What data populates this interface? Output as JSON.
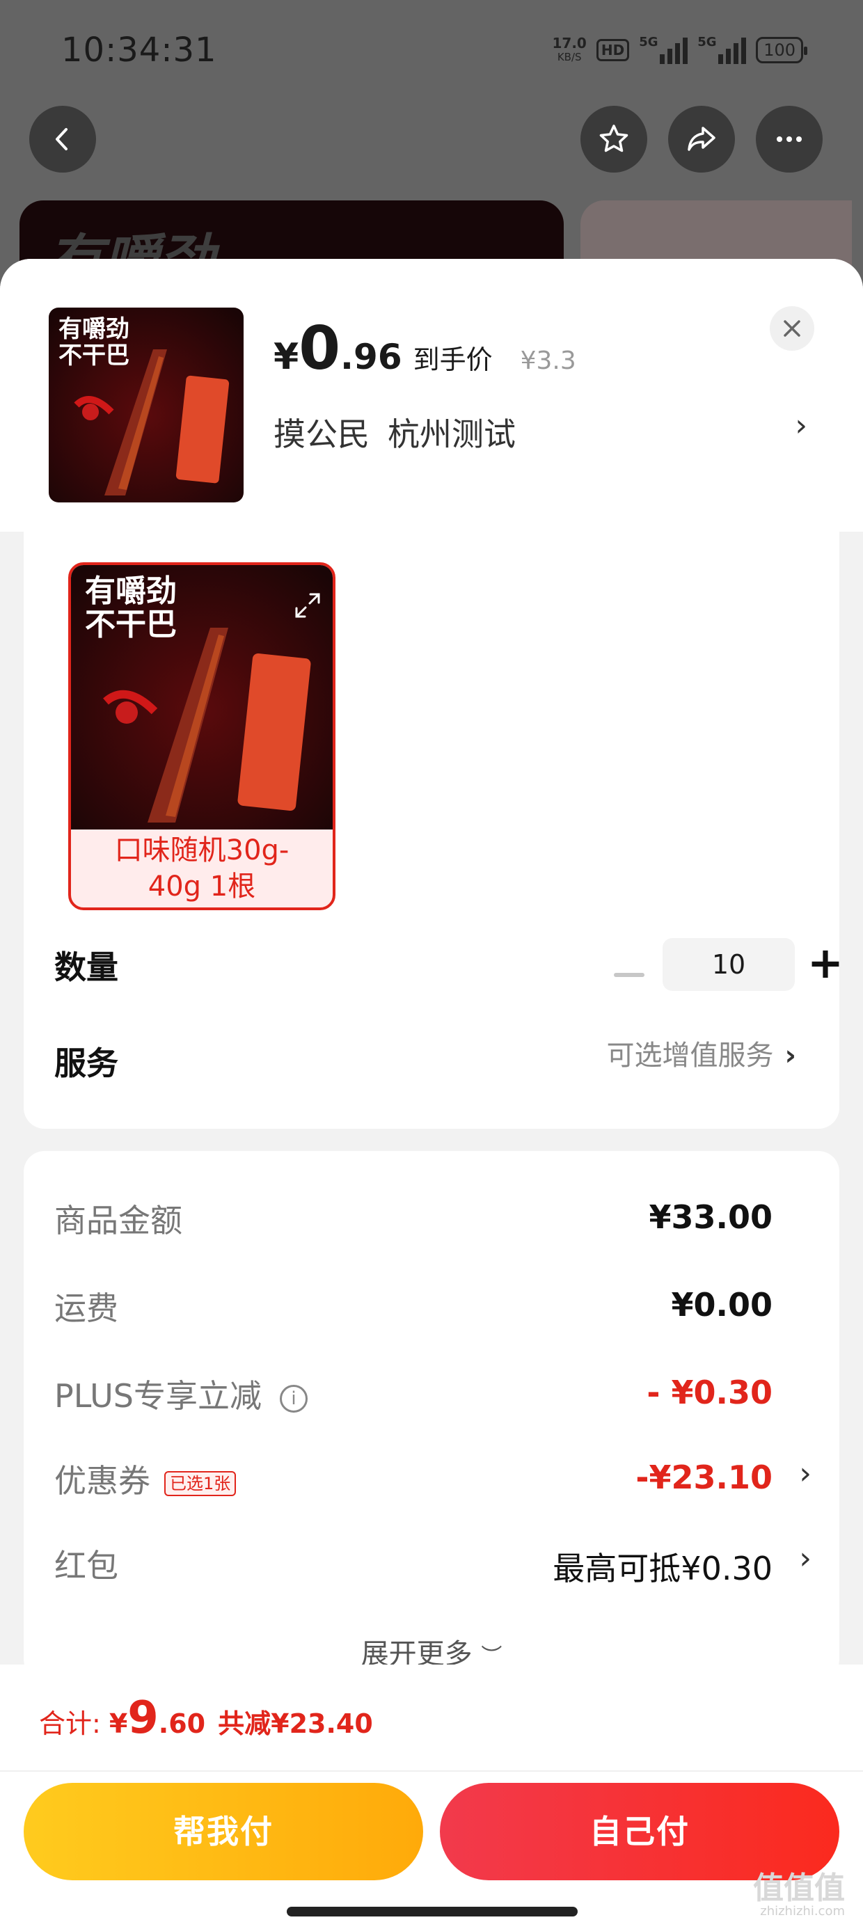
{
  "status_bar": {
    "time": "10:34:31",
    "net_speed": "17.0",
    "net_unit": "KB/S",
    "hd": "HD",
    "sig1": "5G",
    "sig2": "5G",
    "battery": "100"
  },
  "product": {
    "thumb_line1": "有嚼劲",
    "thumb_line2": "不干巴",
    "price_yen": "¥",
    "price_int": "0",
    "price_dec": ".96",
    "price_label": "到手价",
    "original_price": "¥3.3",
    "shop_name": "摸公民",
    "shop_city": "杭州测试"
  },
  "spec": {
    "selected_label_line1": "口味随机30g-",
    "selected_label_line2": "40g 1根",
    "quantity_label": "数量",
    "quantity_value": "10",
    "service_label": "服务",
    "service_hint": "可选增值服务"
  },
  "details": {
    "rows": [
      {
        "label": "商品金额",
        "value": "¥33.00"
      },
      {
        "label": "运费",
        "value": "¥0.00"
      },
      {
        "label": "PLUS专享立减",
        "value": "- ¥0.30"
      },
      {
        "label": "优惠券",
        "badge": "已选1张",
        "value": "-¥23.10"
      },
      {
        "label": "红包",
        "value": "最高可抵¥0.30"
      }
    ],
    "expand_more": "展开更多"
  },
  "footer": {
    "total_label": "合计:",
    "total_yen": "¥",
    "total_int": "9",
    "total_dec": ".60",
    "total_saved": "共减¥23.40",
    "help_pay": "帮我付",
    "self_pay": "自己付"
  },
  "watermark": {
    "text": "值值值",
    "site": "zhizhizhi.com"
  },
  "colors": {
    "accent_red": "#e1251b",
    "help_pay_yellow": "#ffb90f",
    "self_pay_red": "#f5303d"
  },
  "icons": [
    "back-icon",
    "star-icon",
    "share-icon",
    "more-icon",
    "close-icon",
    "expand-icon",
    "info-icon",
    "chevron-right-icon",
    "chevron-down-icon"
  ]
}
